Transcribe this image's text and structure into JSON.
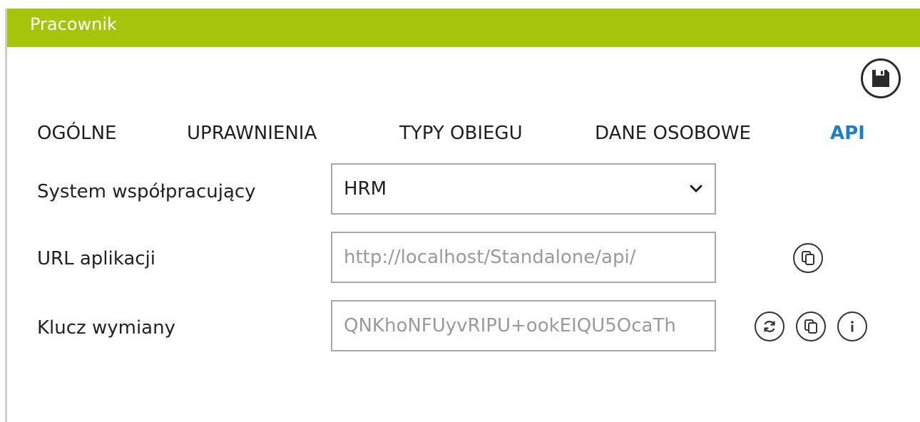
{
  "window": {
    "title": "Pracownik"
  },
  "toolbar": {
    "save_icon": "save-icon"
  },
  "tabs": [
    {
      "label": "OGÓLNE",
      "active": false
    },
    {
      "label": "UPRAWNIENIA",
      "active": false
    },
    {
      "label": "TYPY OBIEGU",
      "active": false
    },
    {
      "label": "DANE OSOBOWE",
      "active": false
    },
    {
      "label": "API",
      "active": true
    }
  ],
  "form": {
    "system": {
      "label": "System współpracujący",
      "value": "HRM",
      "icon": "chevron-down-icon"
    },
    "url": {
      "label": "URL aplikacji",
      "value": "http://localhost/Standalone/api/",
      "actions": [
        "copy-icon"
      ]
    },
    "key": {
      "label": "Klucz wymiany",
      "value": "QNKhoNFUyvRIPU+ookEIQU5OcaTh",
      "actions": [
        "refresh-icon",
        "copy-icon",
        "info-icon"
      ]
    }
  },
  "colors": {
    "header": "#a6c40c",
    "active_tab": "#1e7fc6",
    "header_text": "#ffffff"
  }
}
